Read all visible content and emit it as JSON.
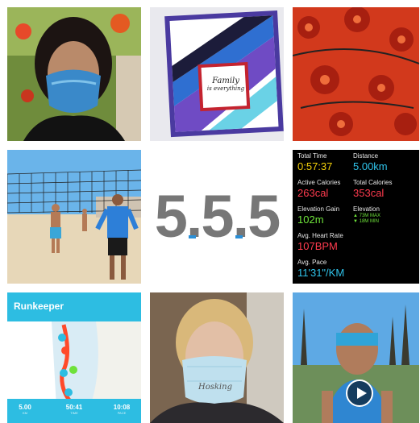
{
  "tiles": {
    "masked_woman": {
      "icon": "photo-mask-portrait"
    },
    "card": {
      "text_line1": "Family",
      "text_line2": "is everything"
    },
    "fabric": {
      "icon": "photo-floral-masks"
    },
    "beach": {
      "icon": "photo-beach-volleyball"
    },
    "counter": {
      "text": "5.5.5"
    },
    "workout": {
      "total_time_label": "Total Time",
      "total_time": "0:57:37",
      "distance_label": "Distance",
      "distance": "5.00km",
      "active_cal_label": "Active Calories",
      "active_cal": "263cal",
      "total_cal_label": "Total Calories",
      "total_cal": "353cal",
      "elev_gain_label": "Elevation Gain",
      "elev_gain": "102m",
      "elevation_label": "Elevation",
      "elev_max": "▲ 73M MAX",
      "elev_min": "▼ 18M MIN",
      "hr_label": "Avg. Heart Rate",
      "hr": "107BPM",
      "pace_label": "Avg. Pace",
      "pace": "11'31\"/KM"
    },
    "runkeeper": {
      "logo": "Runkeeper",
      "stat1": "5.00",
      "stat1_sub": "KM",
      "stat2": "50:41",
      "stat2_sub": "TIME",
      "stat3": "10:08",
      "stat3_sub": "PACE"
    },
    "selfie": {
      "mask_text": "Hosking"
    },
    "runner": {
      "icon": "play-icon"
    }
  },
  "colors": {
    "runkeeper": "#2dbde2",
    "stats_bg": "#000000",
    "blue_dot": "#2b8fd6"
  }
}
